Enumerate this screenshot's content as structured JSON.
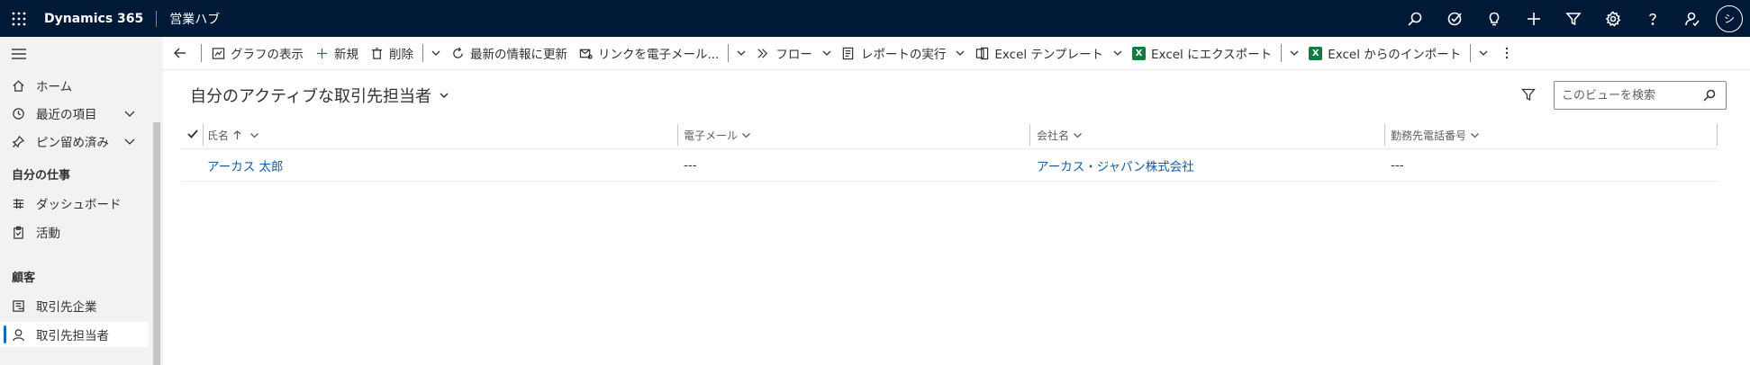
{
  "app": {
    "name": "Dynamics 365",
    "hub": "営業ハブ",
    "avatar_initial": "シ"
  },
  "top_icons": [
    "search-icon",
    "task-flow-icon",
    "lightbulb-icon",
    "plus-icon",
    "filter-icon",
    "settings-icon",
    "help-icon",
    "feedback-icon"
  ],
  "sidebar": {
    "items": [
      {
        "label": "ホーム"
      },
      {
        "label": "最近の項目"
      },
      {
        "label": "ピン留め済み"
      },
      {
        "label": "ダッシュボード"
      },
      {
        "label": "活動"
      },
      {
        "label": "取引先企業"
      },
      {
        "label": "取引先担当者"
      }
    ],
    "section_my_work": "自分の仕事",
    "section_customers": "顧客"
  },
  "commands": {
    "show_chart": "グラフの表示",
    "new": "新規",
    "delete": "削除",
    "refresh": "最新の情報に更新",
    "email_link": "リンクを電子メール...",
    "flow": "フロー",
    "run_report": "レポートの実行",
    "excel_template": "Excel テンプレート",
    "export_excel": "Excel にエクスポート",
    "import_excel": "Excel からのインポート"
  },
  "view": {
    "title": "自分のアクティブな取引先担当者",
    "search_placeholder": "このビューを検索"
  },
  "grid": {
    "columns": [
      "氏名",
      "電子メール",
      "会社名",
      "勤務先電話番号"
    ],
    "rows": [
      [
        "アーカス 太郎",
        "---",
        "アーカス・ジャパン株式会社",
        "---"
      ]
    ]
  },
  "colors": {
    "topbar": "#001936",
    "link": "#115ea3",
    "accent": "#0f6cbd",
    "excel": "#107c41"
  }
}
